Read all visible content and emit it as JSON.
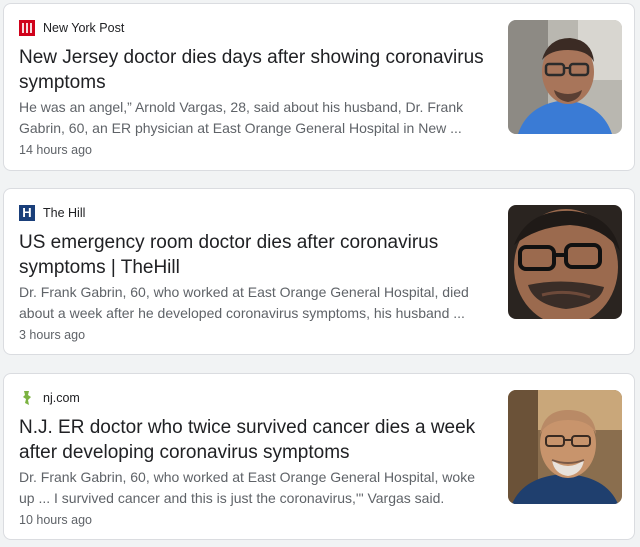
{
  "articles": [
    {
      "source": "New York Post",
      "source_icon": "new-york-post-logo-icon",
      "title": "New Jersey doctor dies days after showing coronavirus symptoms",
      "snippet": "He was an angel,” Arnold Vargas, 28, said about his husband, Dr. Frank Gabrin, 60, an ER physician at East Orange General Hospital in New ...",
      "time": "14 hours ago",
      "thumbnail": "man-with-glasses-video-call-photo"
    },
    {
      "source": "The Hill",
      "source_icon": "the-hill-logo-icon",
      "logo_letter": "H",
      "title": "US emergency room doctor dies after coronavirus symptoms | TheHill",
      "snippet": "Dr. Frank Gabrin, 60, who worked at East Orange General Hospital, died about a week after he developed coronavirus symptoms, his husband ...",
      "time": "3 hours ago",
      "thumbnail": "man-with-glasses-closeup-photo"
    },
    {
      "source": "nj.com",
      "source_icon": "nj-com-logo-icon",
      "title": "N.J. ER doctor who twice survived cancer dies a week after developing coronavirus symptoms",
      "snippet": "Dr. Frank Gabrin, 60, who worked at East Orange General Hospital, woke up ... I survived cancer and this is just the coronavirus,'\" Vargas said.",
      "time": "10 hours ago",
      "thumbnail": "smiling-man-with-glasses-photo"
    }
  ],
  "colors": {
    "background": "#f1f3f4",
    "card": "#ffffff",
    "title": "#202124",
    "snippet": "#5f6368"
  }
}
